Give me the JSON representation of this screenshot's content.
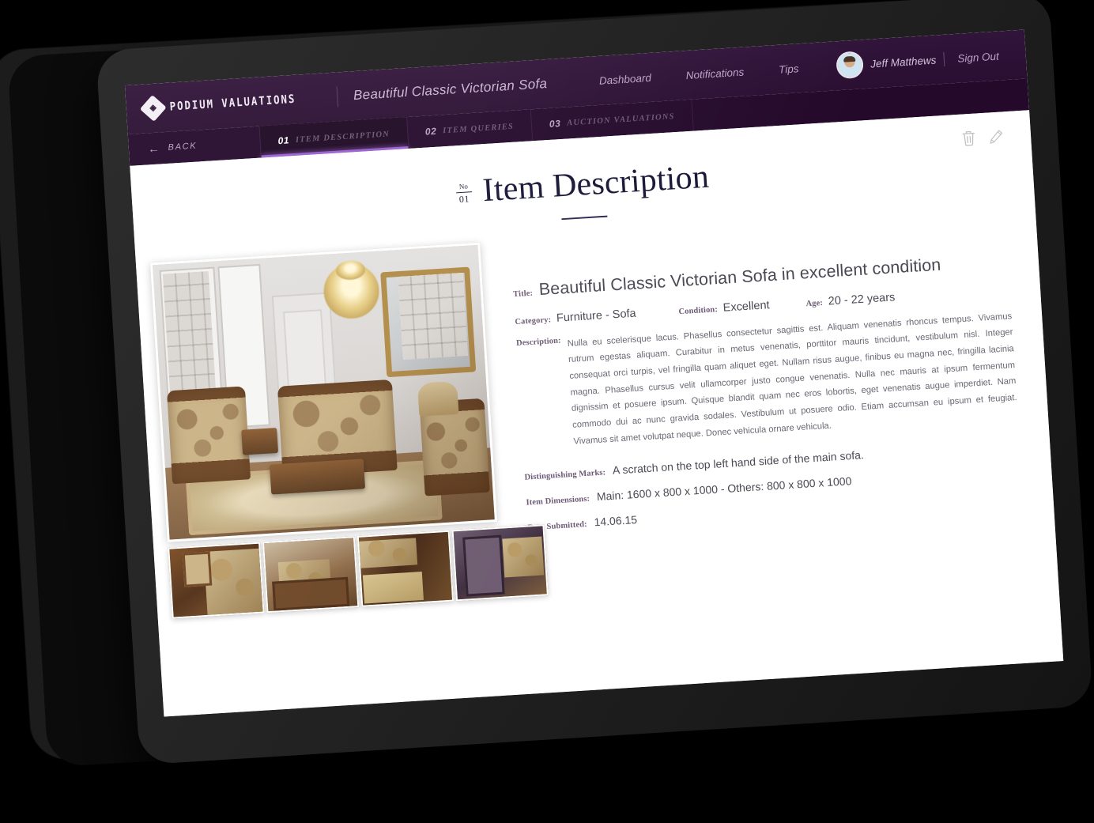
{
  "app": {
    "brand_name": "PODIUM VALUATIONS",
    "logo_glyph": "◈",
    "item_title": "Beautiful Classic Victorian Sofa"
  },
  "header": {
    "nav_links": [
      {
        "label": "Dashboard",
        "name": "nav-dashboard"
      },
      {
        "label": "Notifications",
        "name": "nav-notifications"
      },
      {
        "label": "Tips",
        "name": "nav-tips"
      }
    ],
    "user_name": "Jeff Matthews",
    "sign_out_label": "Sign Out"
  },
  "tabbar": {
    "back_label": "BACK",
    "back_arrow": "←",
    "tabs": [
      {
        "num": "01",
        "label": "ITEM DESCRIPTION",
        "active": true
      },
      {
        "num": "02",
        "label": "ITEM QUERIES",
        "active": false
      },
      {
        "num": "03",
        "label": "AUCTION VALUATIONS",
        "active": false
      }
    ]
  },
  "page": {
    "numero_prefix": "No",
    "numero_value": "01",
    "title": "Item Description",
    "actions": [
      {
        "name": "delete-item-button",
        "icon": "trash-icon"
      },
      {
        "name": "edit-item-button",
        "icon": "pencil-icon"
      }
    ]
  },
  "fields": {
    "title_label": "Title:",
    "title_value": "Beautiful Classic Victorian Sofa in excellent condition",
    "category_label": "Category:",
    "category_value": "Furniture - Sofa",
    "condition_label": "Condition:",
    "condition_value": "Excellent",
    "age_label": "Age:",
    "age_value": "20 - 22 years",
    "description_label": "Description:",
    "description_value": "Nulla eu scelerisque lacus. Phasellus consectetur sagittis est. Aliquam venenatis rhoncus tempus. Vivamus rutrum egestas aliquam. Curabitur in metus venenatis, porttitor mauris tincidunt, vestibulum nisl. Integer consequat orci turpis, vel fringilla quam aliquet eget. Nullam risus augue, finibus eu magna nec, fringilla lacinia magna. Phasellus cursus velit ullamcorper justo congue venenatis. Nulla nec mauris at ipsum fermentum dignissim et posuere ipsum. Quisque blandit quam nec eros lobortis, eget venenatis augue imperdiet. Nam commodo dui ac nunc gravida sodales. Vestibulum ut posuere odio. Etiam accumsan eu ipsum et feugiat. Vivamus sit amet volutpat neque. Donec vehicula ornare vehicula.",
    "marks_label": "Distinguishing Marks:",
    "marks_value": "A scratch on the top left hand side of the main sofa.",
    "dimensions_label": "Item Dimensions:",
    "dimensions_value": "Main: 1600 x 800 x 1000 - Others: 800 x 800 x 1000",
    "date_label": "Date Submitted:",
    "date_value": "14.06.15"
  },
  "gallery": {
    "hero_alt": "Victorian living room set with carved sofa, armchairs and coffee table",
    "thumbs": [
      {
        "alt": "Carved armchair arm detail with side table"
      },
      {
        "alt": "Full living room set wide view"
      },
      {
        "alt": "Close-up of carved wooden sofa arm"
      },
      {
        "alt": "Wing chair and rolled sofa arm detail"
      }
    ]
  },
  "colors": {
    "header_purple": "#2b1033",
    "tabbar_purple": "#24092b",
    "active_tab": "#1c0722",
    "accent_underline": "#9a5fd0",
    "label_mauve": "#6b5874",
    "title_ink": "#171535",
    "bezel": "#242424"
  }
}
